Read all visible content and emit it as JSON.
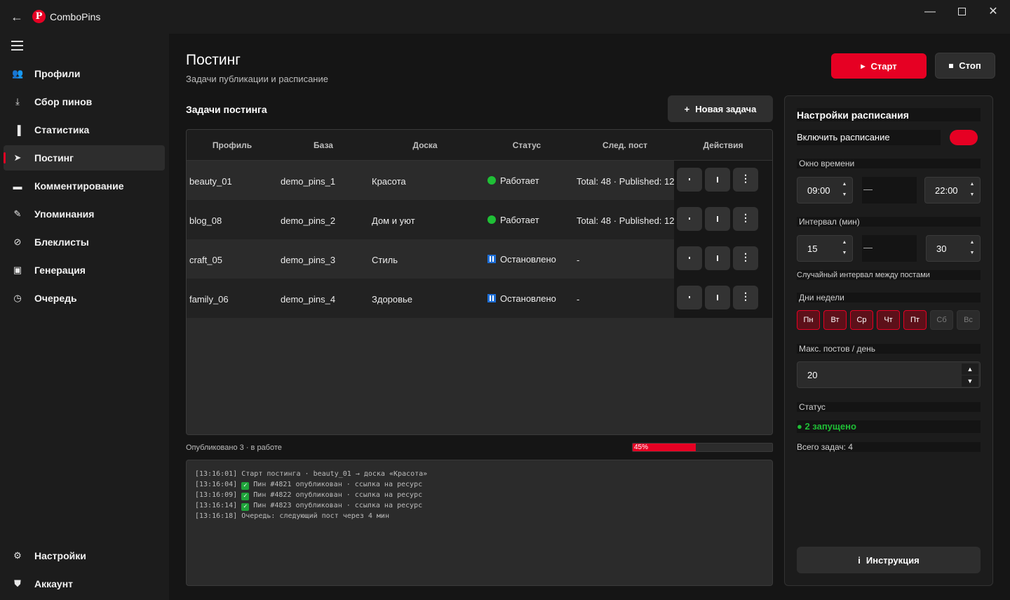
{
  "titlebar": {
    "app_name": "ComboPins",
    "logo_letter": "P"
  },
  "sidebar": {
    "items": [
      {
        "id": "profiles",
        "label": "Профили",
        "icon": "users-icon"
      },
      {
        "id": "collect",
        "label": "Сбор пинов",
        "icon": "download-icon"
      },
      {
        "id": "stats",
        "label": "Статистика",
        "icon": "bar-chart-icon"
      },
      {
        "id": "posting",
        "label": "Постинг",
        "icon": "send-icon",
        "active": true
      },
      {
        "id": "comments",
        "label": "Комментирование",
        "icon": "comment-icon"
      },
      {
        "id": "mentions",
        "label": "Упоминания",
        "icon": "pin-icon"
      },
      {
        "id": "blacklists",
        "label": "Блеклисты",
        "icon": "block-icon"
      },
      {
        "id": "generation",
        "label": "Генерация",
        "icon": "image-icon"
      },
      {
        "id": "queue",
        "label": "Очередь",
        "icon": "clock-icon"
      }
    ],
    "bottom": [
      {
        "id": "settings",
        "label": "Настройки",
        "icon": "gear-icon"
      },
      {
        "id": "account",
        "label": "Аккаунт",
        "icon": "shield-icon"
      }
    ]
  },
  "header": {
    "title": "Постинг",
    "subtitle": "Задачи публикации и расписание",
    "start_label": "Старт",
    "stop_label": "Стоп"
  },
  "tasks": {
    "title": "Задачи постинга",
    "new_label": "Новая задача",
    "columns": [
      "Профиль",
      "База",
      "Доска",
      "Статус",
      "След. пост",
      "Действия"
    ],
    "rows": [
      {
        "profile": "beauty_01",
        "base": "demo_pins_1",
        "board": "Красота",
        "status": "Работает",
        "running": true,
        "next": "Total: 48 · Published: 12"
      },
      {
        "profile": "blog_08",
        "base": "demo_pins_2",
        "board": "Дом и уют",
        "status": "Работает",
        "running": true,
        "next": "Total: 48 · Published: 12"
      },
      {
        "profile": "craft_05",
        "base": "demo_pins_3",
        "board": "Стиль",
        "status": "Остановлено",
        "running": false,
        "next": "-"
      },
      {
        "profile": "family_06",
        "base": "demo_pins_4",
        "board": "Здоровье",
        "status": "Остановлено",
        "running": false,
        "next": "-"
      }
    ],
    "more_glyph": "⋮"
  },
  "progress": {
    "label": "Опубликовано 3 · в работе",
    "percent": 45,
    "percent_text": "45%"
  },
  "log": {
    "lines": [
      {
        "time": "[13:16:01]",
        "check": false,
        "text": "Старт постинга · beauty_01 → доска «Красота»"
      },
      {
        "time": "[13:16:04]",
        "check": true,
        "text": "Пин #4821 опубликован · ссылка на ресурс"
      },
      {
        "time": "[13:16:09]",
        "check": true,
        "text": "Пин #4822 опубликован · ссылка на ресурс"
      },
      {
        "time": "[13:16:14]",
        "check": true,
        "text": "Пин #4823 опубликован · ссылка на ресурс"
      },
      {
        "time": "[13:16:18]",
        "check": false,
        "text": "Очередь: следующий пост через 4 мин"
      }
    ]
  },
  "schedule": {
    "title": "Настройки расписания",
    "enable_label": "Включить расписание",
    "enabled": true,
    "window_label": "Окно времени",
    "window_from": "09:00",
    "window_to": "22:00",
    "dash": "—",
    "interval_label": "Интервал (мин)",
    "interval_from": "15",
    "interval_to": "30",
    "random_hint": "Случайный интервал между постами",
    "days_label": "Дни недели",
    "days": [
      {
        "label": "Пн",
        "on": true
      },
      {
        "label": "Вт",
        "on": true
      },
      {
        "label": "Ср",
        "on": true
      },
      {
        "label": "Чт",
        "on": true
      },
      {
        "label": "Пт",
        "on": true
      },
      {
        "label": "Сб",
        "on": false
      },
      {
        "label": "Вс",
        "on": false
      }
    ],
    "max_label": "Макс. постов / день",
    "max_value": "20",
    "status_label": "Статус",
    "status_value": "● 2 запущено",
    "total_label": "Всего задач: 4",
    "help_label": "Инструкция"
  },
  "colors": {
    "accent": "#e60023",
    "ok": "#1fbf36",
    "paused": "#1f6fd6"
  }
}
